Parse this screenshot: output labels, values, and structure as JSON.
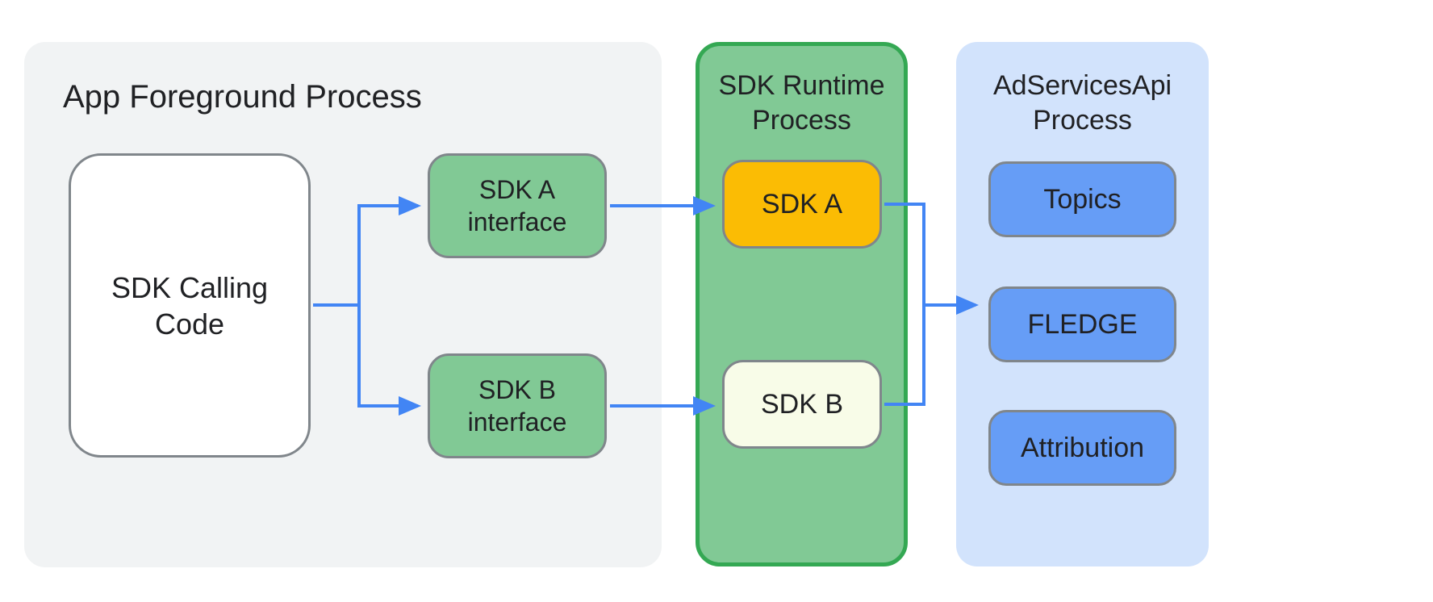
{
  "app_foreground": {
    "title": "App Foreground Process",
    "sdk_calling_label": "SDK Calling\nCode",
    "sdk_a_interface_label": "SDK A\ninterface",
    "sdk_b_interface_label": "SDK B\ninterface"
  },
  "sdk_runtime": {
    "title": "SDK Runtime\nProcess",
    "sdk_a_label": "SDK A",
    "sdk_b_label": "SDK B"
  },
  "adservices": {
    "title": "AdServicesApi\nProcess",
    "apis": {
      "topics": "Topics",
      "fledge": "FLEDGE",
      "attribution": "Attribution"
    }
  },
  "colors": {
    "arrow": "#4285f4"
  }
}
